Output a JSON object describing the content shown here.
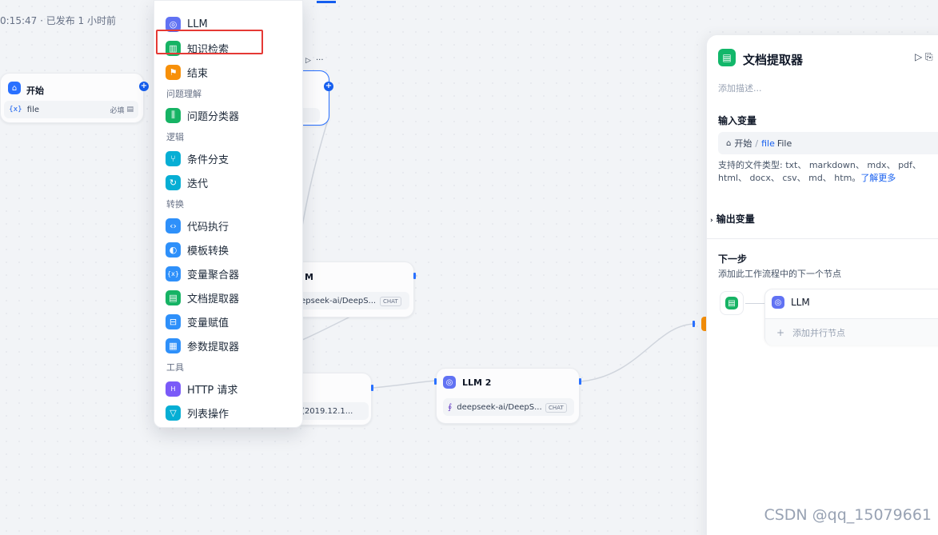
{
  "top_status": "0:15:47 · 已发布 1 小时前",
  "colors": {
    "accent": "#155eef",
    "highlight_border": "#e53935"
  },
  "start_node": {
    "title": "开始",
    "var_prefix": "{x}",
    "var_name": "file",
    "required": "必填"
  },
  "hidden_llm_node": {
    "title_fragment": "M",
    "model": "eepseek-ai/DeepS...",
    "tag": "CHAT"
  },
  "hidden_node_bottom": {
    "text": "(2019.12.1..."
  },
  "llm2_node": {
    "title": "LLM 2",
    "model": "deepseek-ai/DeepS...",
    "tag": "CHAT"
  },
  "menu": {
    "items_top": [
      {
        "label": "LLM",
        "icon": "llm-icon",
        "color": "#6172f3"
      },
      {
        "label": "知识检索",
        "icon": "book-icon",
        "color": "#16b364"
      },
      {
        "label": "结束",
        "icon": "flag-icon",
        "color": "#f79009"
      }
    ],
    "cat_understanding": "问题理解",
    "items_understanding": [
      {
        "label": "问题分类器",
        "icon": "classifier-icon",
        "color": "#16b364"
      }
    ],
    "cat_logic": "逻辑",
    "items_logic": [
      {
        "label": "条件分支",
        "icon": "branch-icon",
        "color": "#06aed4"
      },
      {
        "label": "迭代",
        "icon": "loop-icon",
        "color": "#06aed4"
      }
    ],
    "cat_transform": "转换",
    "items_transform": [
      {
        "label": "代码执行",
        "icon": "code-icon",
        "color": "#2e90fa"
      },
      {
        "label": "模板转换",
        "icon": "template-icon",
        "color": "#2e90fa"
      },
      {
        "label": "变量聚合器",
        "icon": "variable-icon",
        "color": "#2e90fa"
      },
      {
        "label": "文档提取器",
        "icon": "doc-extract-icon",
        "color": "#16b364"
      },
      {
        "label": "变量赋值",
        "icon": "assign-icon",
        "color": "#2e90fa"
      },
      {
        "label": "参数提取器",
        "icon": "param-icon",
        "color": "#2e90fa"
      }
    ],
    "cat_tools": "工具",
    "items_tools": [
      {
        "label": "HTTP 请求",
        "icon": "http-icon",
        "color": "#7a5af8"
      },
      {
        "label": "列表操作",
        "icon": "filter-icon",
        "color": "#06aed4"
      }
    ]
  },
  "panel": {
    "title": "文档提取器",
    "desc": "添加描述...",
    "input_section": "输入变量",
    "input_source": "开始",
    "input_sep": "/",
    "input_var": "file",
    "input_type": "File",
    "support_text": "支持的文件类型: txt、 markdown、 mdx、 pdf、 html、 docx、 csv、 md、 htm。",
    "learn_more": "了解更多",
    "output_section": "输出变量",
    "next_section": "下一步",
    "next_sub": "添加此工作流程中的下一个节点",
    "next_node": "LLM",
    "add_parallel": "添加并行节点"
  },
  "watermark": "CSDN @qq_15079661"
}
